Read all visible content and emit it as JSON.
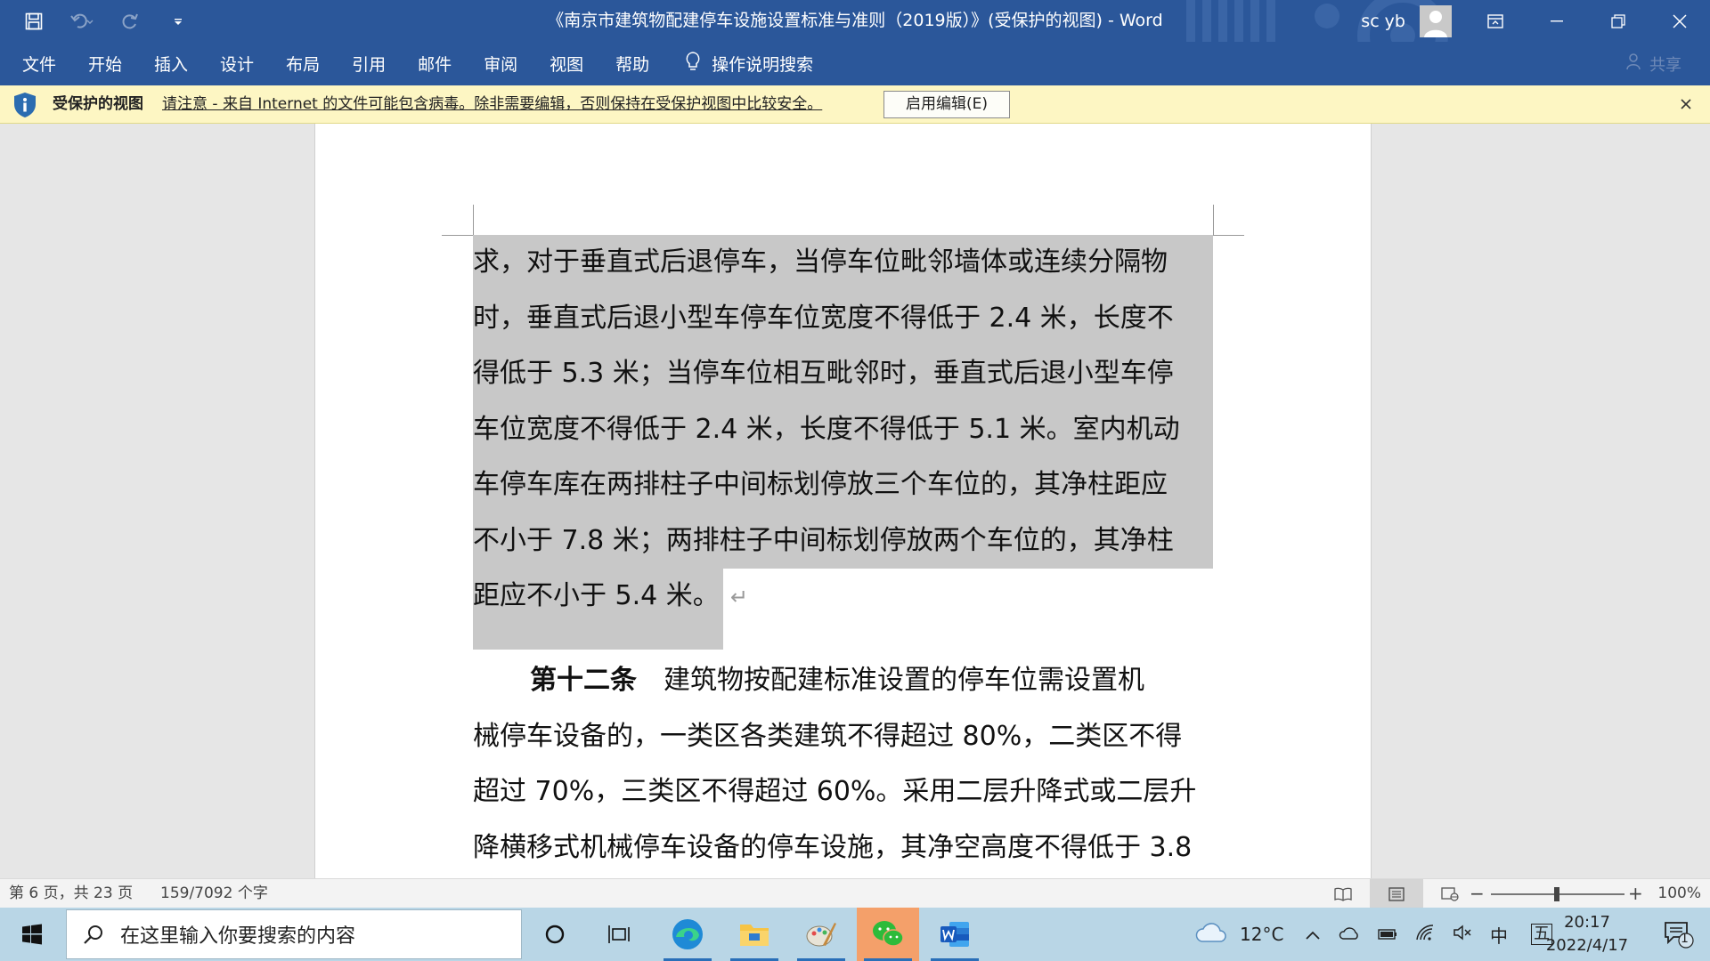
{
  "window": {
    "title": "《南京市建筑物配建停车设施设置标准与准则（2019版）》(受保护的视图)  -  Word",
    "user": "sc yb"
  },
  "menu": {
    "items": [
      "文件",
      "开始",
      "插入",
      "设计",
      "布局",
      "引用",
      "邮件",
      "审阅",
      "视图",
      "帮助"
    ],
    "tell_me": "操作说明搜索",
    "share": "共享"
  },
  "protected_view": {
    "title": "受保护的视图",
    "message": "请注意 - 来自 Internet 的文件可能包含病毒。除非需要编辑，否则保持在受保护视图中比较安全。",
    "enable_button": "启用编辑(E)"
  },
  "document": {
    "selected_lines": [
      "求，对于垂直式后退停车，当停车位毗邻墙体或连续分隔物",
      "时，垂直式后退小型车停车位宽度不得低于 2.4 米，长度不",
      "得低于 5.3 米；当停车位相互毗邻时，垂直式后退小型车停",
      "车位宽度不得低于 2.4 米，长度不得低于 5.1 米。室内机动",
      "车停车库在两排柱子中间标划停放三个车位的，其净柱距应",
      "不小于 7.8 米；两排柱子中间标划停放两个车位的，其净柱",
      "距应不小于 5.4 米。"
    ],
    "article_heading": "第十二条",
    "article_first_line": "建筑物按配建标准设置的停车位需设置机",
    "article_lines": [
      "械停车设备的，一类区各类建筑不得超过 80%，二类区不得",
      "超过 70%，三类区不得超过 60%。采用二层升降式或二层升",
      "降横移式机械停车设备的停车设施，其净空高度不得低于 3.8"
    ]
  },
  "status": {
    "page_info": "第 6 页，共 23 页",
    "word_count": "159/7092 个字",
    "zoom": "100%",
    "zoom_minus": "−",
    "zoom_plus": "+"
  },
  "taskbar": {
    "search_placeholder": "在这里输入你要搜索的内容",
    "weather": "12°C",
    "ime_lang": "中",
    "ime_mode": "五",
    "time": "20:17",
    "date": "2022/4/17",
    "notification_count": "1"
  },
  "colors": {
    "word_blue": "#2b579a",
    "protected_bar": "#fdf6c3",
    "selection": "#c8c8c8",
    "taskbar": "#b9d6e6"
  }
}
